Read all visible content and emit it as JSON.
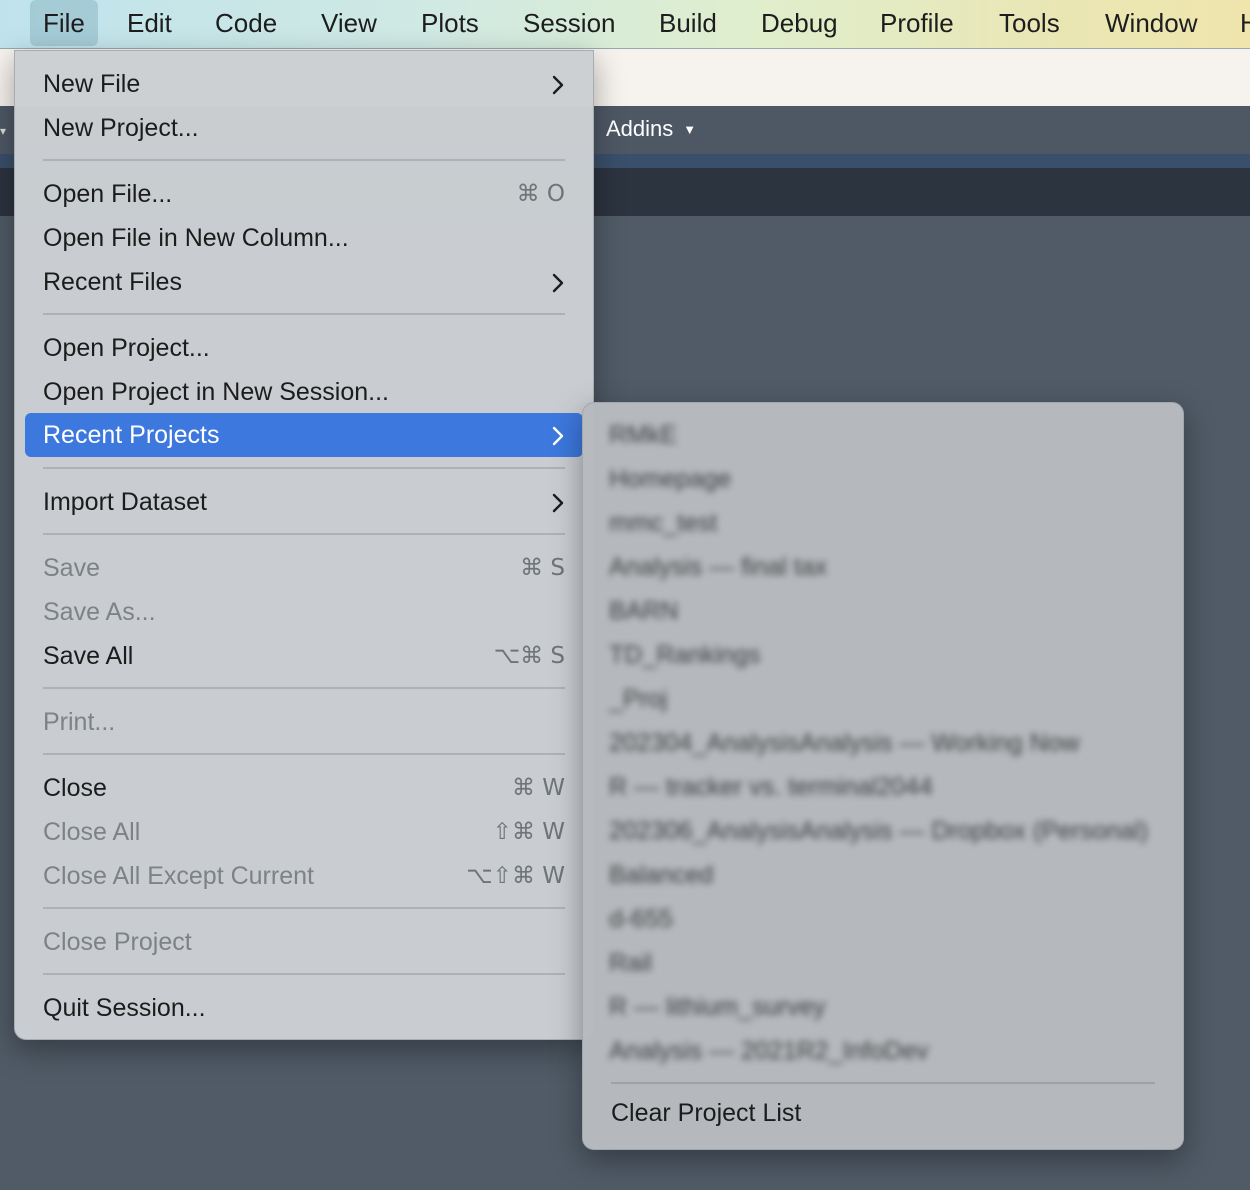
{
  "menubar": {
    "items": [
      "File",
      "Edit",
      "Code",
      "View",
      "Plots",
      "Session",
      "Build",
      "Debug",
      "Profile",
      "Tools",
      "Window",
      "H"
    ]
  },
  "toolbar": {
    "addins_label": "Addins"
  },
  "file_menu": {
    "new_file": "New File",
    "new_project": "New Project...",
    "open_file": "Open File...",
    "open_file_shortcut": "⌘ O",
    "open_file_new_column": "Open File in New Column...",
    "recent_files": "Recent Files",
    "open_project": "Open Project...",
    "open_project_new_session": "Open Project in New Session...",
    "recent_projects": "Recent Projects",
    "import_dataset": "Import Dataset",
    "save": "Save",
    "save_shortcut": "⌘ S",
    "save_as": "Save As...",
    "save_all": "Save All",
    "save_all_shortcut": "⌥⌘ S",
    "print": "Print...",
    "close": "Close",
    "close_shortcut": "⌘ W",
    "close_all": "Close All",
    "close_all_shortcut": "⇧⌘ W",
    "close_all_except_current": "Close All Except Current",
    "close_all_except_current_shortcut": "⌥⇧⌘ W",
    "close_project": "Close Project",
    "quit_session": "Quit Session..."
  },
  "recent_projects_menu": {
    "projects": [
      "RMkE",
      "Homepage",
      "mmc_test",
      "Analysis — final tax",
      "BARN",
      "TD_Rankings",
      "_Proj",
      "202304_AnalysisAnalysis — Working Now",
      "R — tracker vs. terminal2044",
      "202306_AnalysisAnalysis — Dropbox (Personal)",
      "Balanced",
      "d-655",
      "Rail",
      "R — lithium_survey",
      "Analysis — 2021R2_InfoDev"
    ],
    "clear_label": "Clear Project List"
  }
}
